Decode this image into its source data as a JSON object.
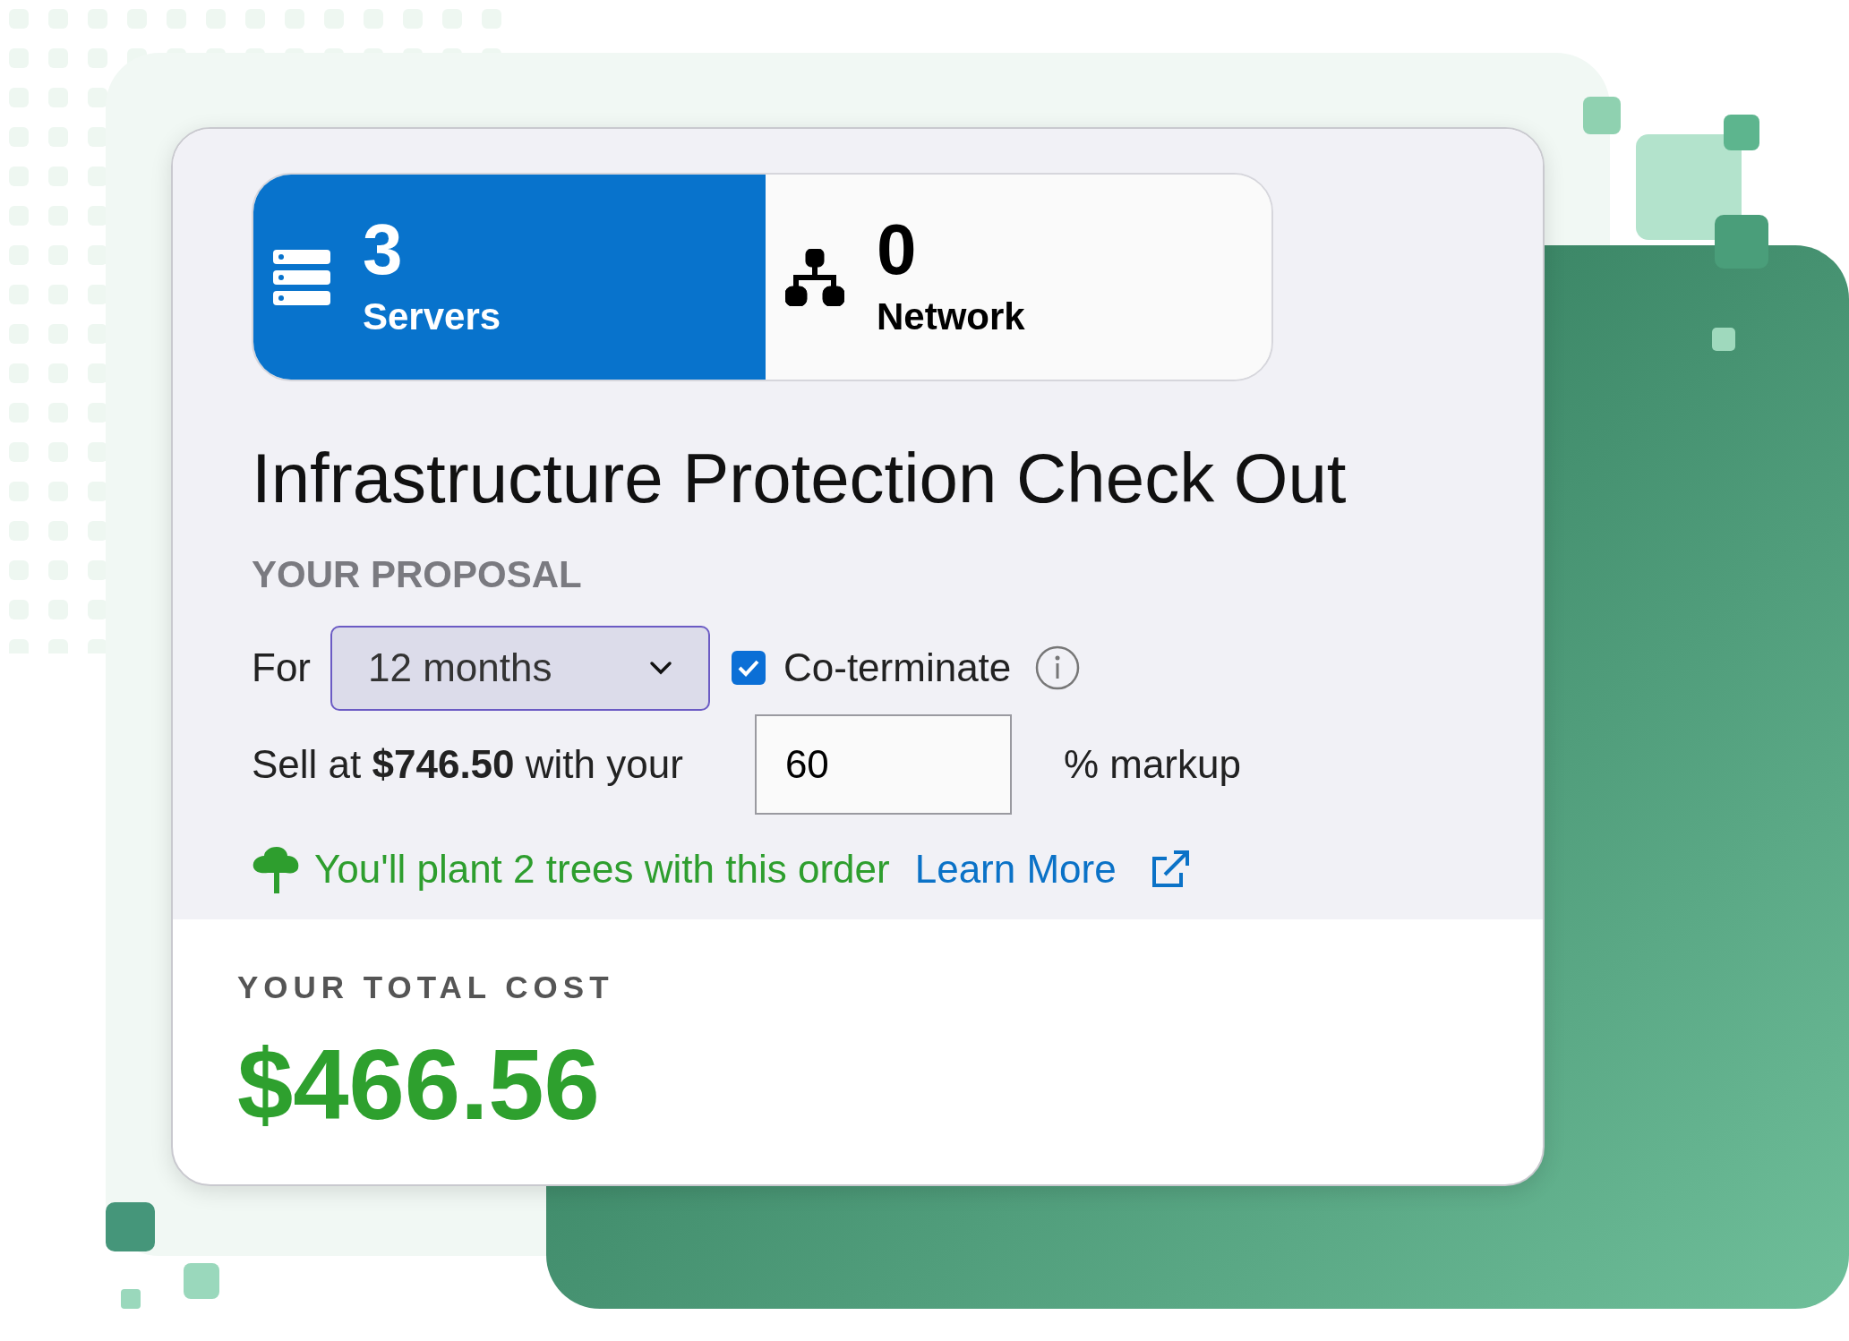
{
  "tabs": [
    {
      "kind": "servers",
      "count": "3",
      "label": "Servers",
      "selected": true
    },
    {
      "kind": "network",
      "count": "0",
      "label": "Network",
      "selected": false
    }
  ],
  "title": "Infrastructure Protection Check Out",
  "proposal": {
    "heading": "YOUR PROPOSAL",
    "for_label": "For",
    "term": "12 months",
    "coterminate": {
      "label": "Co-terminate",
      "checked": true
    },
    "sell_text": "Sell at **$746.50** with your",
    "markup": "60",
    "markup_label": "% markup",
    "trees_text": "You'll plant 2 trees with this order",
    "learn_more": "Learn More"
  },
  "total": {
    "label": "YOUR TOTAL COST",
    "amount": "$466.56"
  }
}
